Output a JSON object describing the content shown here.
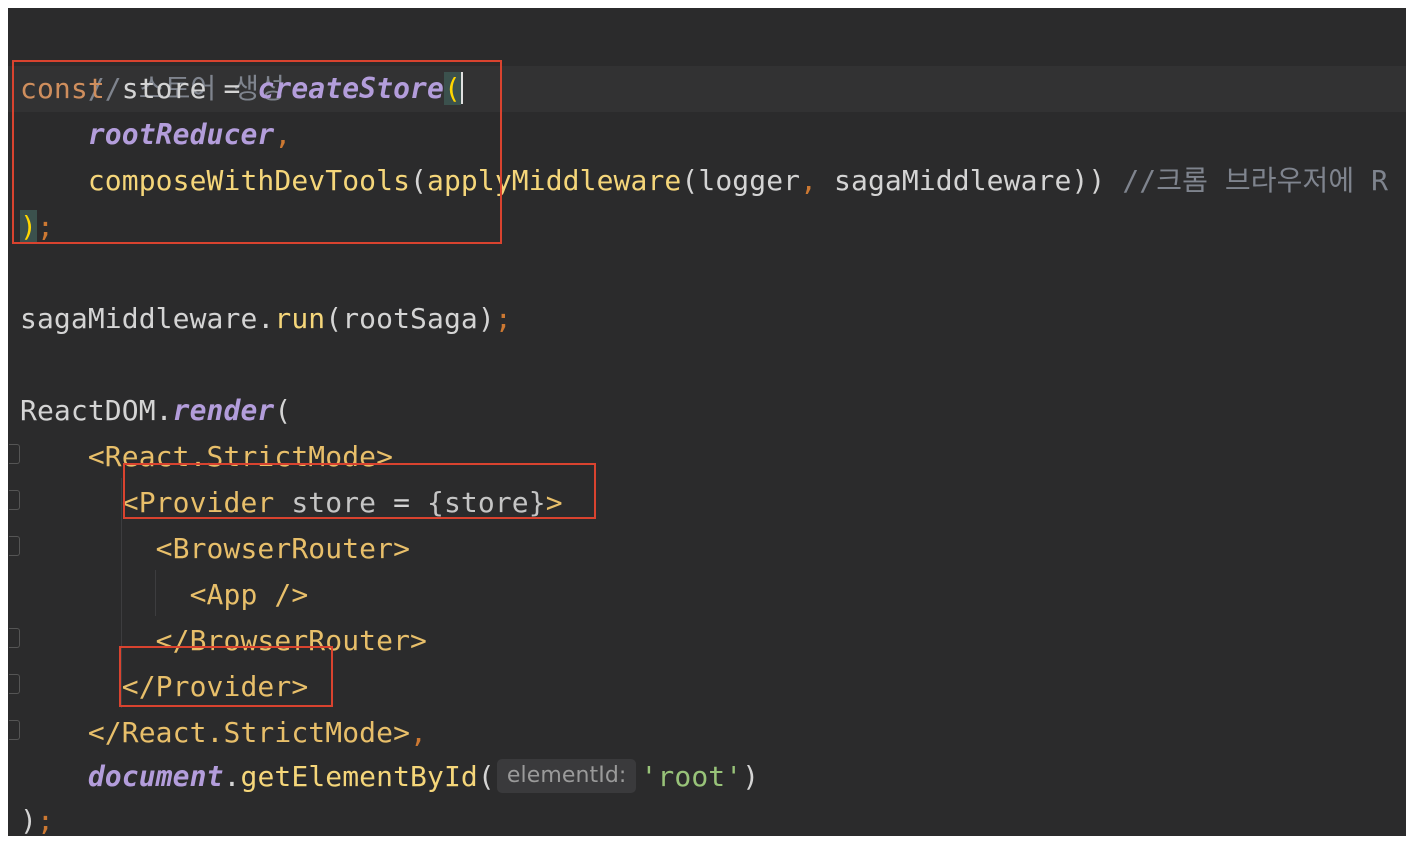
{
  "editor": {
    "lines": {
      "comment": "// 스토어 생성",
      "l2_kw": "const",
      "l2_var": " store ",
      "l2_op": "=",
      "l2_fn": "createStore",
      "l2_paren": "(",
      "l3_arg": "rootReducer",
      "l3_comma": ",",
      "l4_fn1": "composeWithDevTools",
      "l4_p1": "(",
      "l4_fn2": "applyMiddleware",
      "l4_p2": "(",
      "l4_a1": "logger",
      "l4_comma": ",",
      "l4_a2": " sagaMiddleware",
      "l4_close": "))",
      "l4_comment": " //크롬 브라우저에 R",
      "l5_paren": ")",
      "l5_semi": ";",
      "l7_obj": "sagaMiddleware.",
      "l7_fn": "run",
      "l7_args": "(rootSaga)",
      "l7_semi": ";",
      "l9_obj": "ReactDOM.",
      "l9_fn": "render",
      "l9_paren": "(",
      "l10_tag": "<React.StrictMode>",
      "l11_tag_open": "<Provider",
      "l11_attr": " store ",
      "l11_op": "=",
      "l11_val": " {store}",
      "l11_tag_close": ">",
      "l12_tag": "<BrowserRouter>",
      "l13_tag": "<App />",
      "l14_tag": "</BrowserRouter>",
      "l15_tag": "</Provider>",
      "l16_tag": "</React.StrictMode>",
      "l16_comma": ",",
      "l17_obj": "document",
      "l17_dot": ".",
      "l17_fn": "getElementById",
      "l17_paren": "(",
      "l17_hint": "elementId:",
      "l17_str": "'root'",
      "l17_close": ")",
      "l18_paren": ")",
      "l18_semi": ";"
    }
  },
  "colors": {
    "background": "#2b2b2c",
    "highlight_box": "#d9432f",
    "keyword": "#cf8e5d",
    "function": "#f5d67a",
    "italic_function": "#b39ddb",
    "string": "#98c379",
    "comment": "#7f848e"
  }
}
